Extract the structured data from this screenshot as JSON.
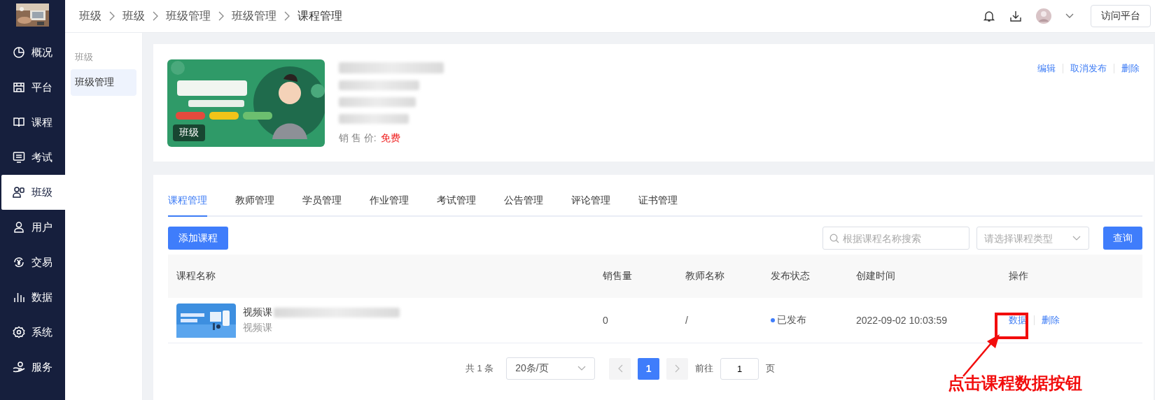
{
  "sidebar": {
    "items": [
      {
        "label": "概况",
        "selected": false
      },
      {
        "label": "平台",
        "selected": false
      },
      {
        "label": "课程",
        "selected": false
      },
      {
        "label": "考试",
        "selected": false
      },
      {
        "label": "班级",
        "selected": true
      },
      {
        "label": "用户",
        "selected": false
      },
      {
        "label": "交易",
        "selected": false
      },
      {
        "label": "数据",
        "selected": false
      },
      {
        "label": "系统",
        "selected": false
      },
      {
        "label": "服务",
        "selected": false
      }
    ]
  },
  "breadcrumb": [
    "班级",
    "班级",
    "班级管理",
    "班级管理",
    "课程管理"
  ],
  "header": {
    "button": "访问平台"
  },
  "subnav": {
    "group": "班级",
    "items": [
      {
        "label": "班级管理",
        "selected": true
      }
    ]
  },
  "class_card": {
    "badge": "班级",
    "price_label": "销 售 价:",
    "price": "免费",
    "actions": [
      "编辑",
      "取消发布",
      "删除"
    ]
  },
  "tabs": [
    {
      "label": "课程管理",
      "selected": true
    },
    {
      "label": "教师管理",
      "selected": false
    },
    {
      "label": "学员管理",
      "selected": false
    },
    {
      "label": "作业管理",
      "selected": false
    },
    {
      "label": "考试管理",
      "selected": false
    },
    {
      "label": "公告管理",
      "selected": false
    },
    {
      "label": "评论管理",
      "selected": false
    },
    {
      "label": "证书管理",
      "selected": false
    }
  ],
  "toolbar": {
    "add_button": "添加课程",
    "search": {
      "placeholder": "根据课程名称搜索"
    },
    "type_select": {
      "placeholder": "请选择课程类型"
    },
    "query_button": "查询"
  },
  "table": {
    "columns": [
      "课程名称",
      "销售量",
      "教师名称",
      "发布状态",
      "创建时间",
      "操作"
    ],
    "rows": [
      {
        "name": "视频课",
        "type": "视频课",
        "sales": "0",
        "teacher": "/",
        "status": "已发布",
        "created": "2022-09-02 10:03:59",
        "actions": [
          "数据",
          "删除"
        ]
      }
    ]
  },
  "pagination": {
    "total": "共 1 条",
    "page_size": "20条/页",
    "pages": [
      {
        "label": "1",
        "selected": true
      }
    ],
    "goto_label": "前往",
    "goto_value": "1",
    "goto_suffix": "页"
  },
  "annotation": {
    "text": "点击课程数据按钮"
  }
}
